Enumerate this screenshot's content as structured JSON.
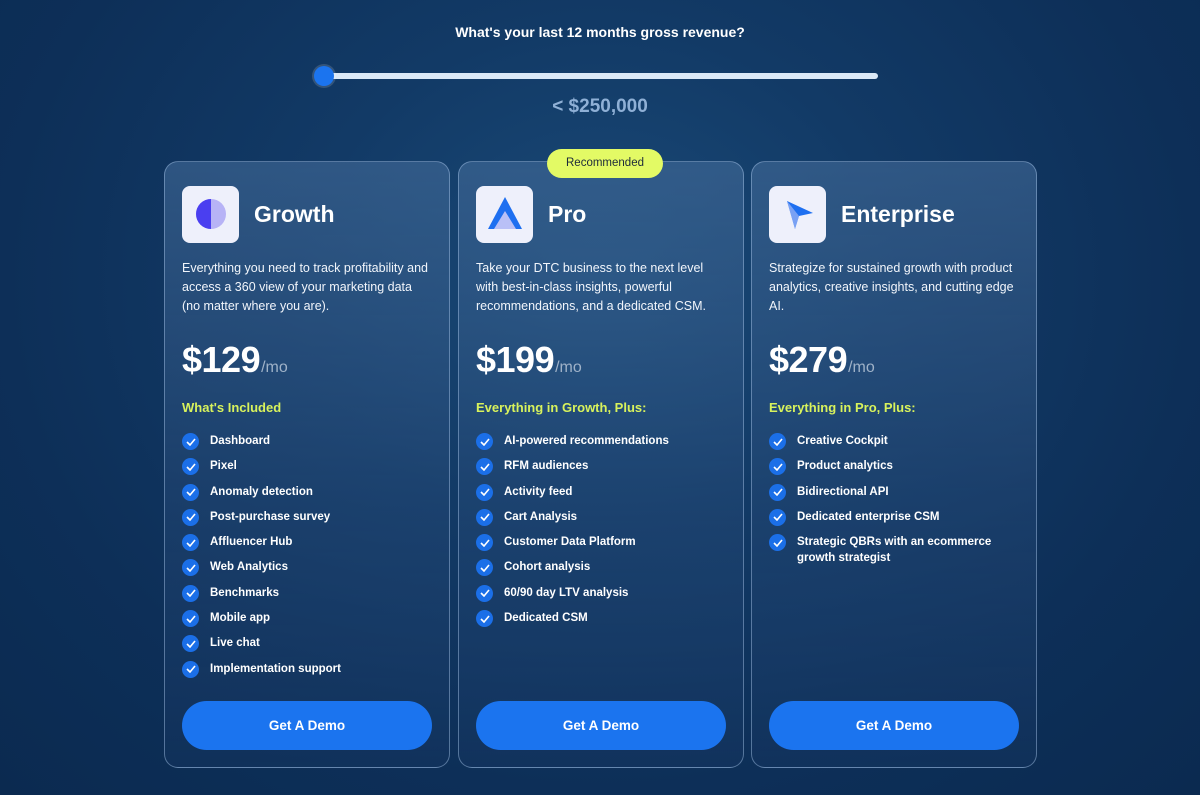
{
  "revenue": {
    "question": "What's your last 12 months gross revenue?",
    "value_label": "< $250,000",
    "slider_value": 0,
    "colors": {
      "track": "#dbe9f7",
      "thumb": "#1b74ef"
    }
  },
  "recommended_badge": "Recommended",
  "plans": [
    {
      "name": "Growth",
      "icon": "half-circle-icon",
      "description": "Everything you need to track profitability and access a 360 view of your marketing data (no matter where you are).",
      "price": "$129",
      "period": "/mo",
      "included_heading": "What's Included",
      "features": [
        "Dashboard",
        "Pixel",
        "Anomaly detection",
        "Post-purchase survey",
        "Affluencer Hub",
        "Web Analytics",
        "Benchmarks",
        "Mobile app",
        "Live chat",
        "Implementation support"
      ],
      "button": "Get A Demo"
    },
    {
      "name": "Pro",
      "icon": "triangle-icon",
      "description": "Take your DTC business to the next level with best-in-class insights, powerful recommendations, and a dedicated CSM.",
      "price": "$199",
      "period": "/mo",
      "included_heading": "Everything in Growth, Plus:",
      "features": [
        "AI-powered recommendations",
        "RFM audiences",
        "Activity feed",
        "Cart Analysis",
        "Customer Data Platform",
        "Cohort analysis",
        "60/90 day LTV analysis",
        "Dedicated CSM"
      ],
      "button": "Get A Demo"
    },
    {
      "name": "Enterprise",
      "icon": "arrow-cursor-icon",
      "description": "Strategize for sustained growth with product analytics, creative insights, and cutting edge AI.",
      "price": "$279",
      "period": "/mo",
      "included_heading": "Everything in Pro, Plus:",
      "features": [
        "Creative Cockpit",
        "Product analytics",
        "Bidirectional API",
        "Dedicated enterprise CSM",
        "Strategic QBRs with an ecommerce growth strategist"
      ],
      "button": "Get A Demo"
    }
  ],
  "colors": {
    "accent": "#1b74ef",
    "highlight": "#d8f25c",
    "badge": "#e3fa65"
  }
}
